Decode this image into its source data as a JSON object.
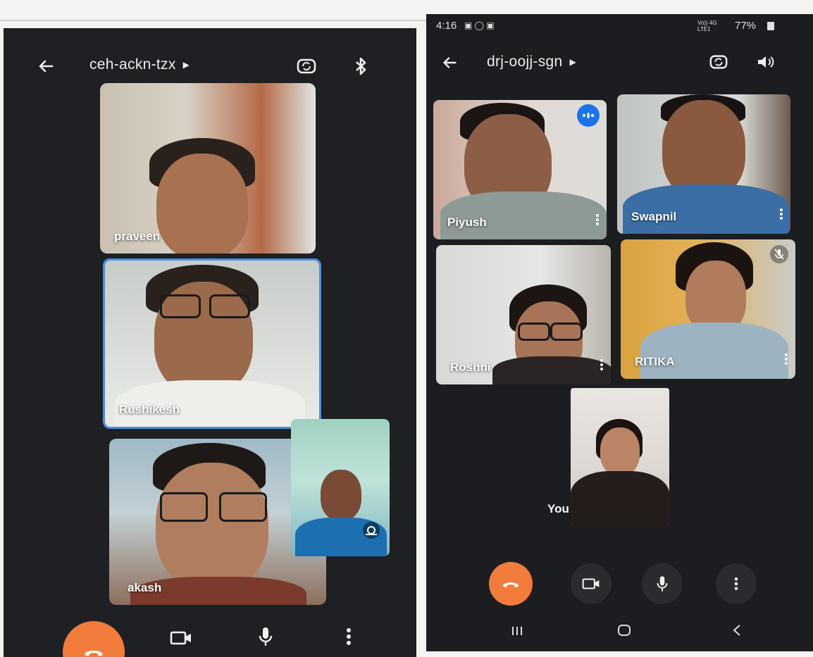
{
  "left_phone": {
    "meeting_code": "ceh-ackn-tzx",
    "icons": {
      "back": "arrow-left-icon",
      "switch_camera": "switch-camera-icon",
      "audio_output": "bluetooth-icon"
    },
    "participants": [
      {
        "name": "praveen"
      },
      {
        "name": "Rushikesh",
        "active_speaker": true
      },
      {
        "name": "akash"
      }
    ],
    "self_view": {
      "name": ""
    },
    "controls": [
      "end-call-icon",
      "camera-icon",
      "microphone-icon",
      "more-options-icon"
    ],
    "colors": {
      "end_call": "#f27c3c",
      "active_border": "#4a90e2",
      "background": "#1f2023"
    }
  },
  "right_phone": {
    "status": {
      "time": "4:16",
      "network": "Vo)) 4G LTE1",
      "battery": "77%"
    },
    "meeting_code": "drj-oojj-sgn",
    "icons": {
      "back": "arrow-left-icon",
      "switch_camera": "switch-camera-icon",
      "audio_output": "speaker-icon"
    },
    "participants": [
      {
        "name": "Piyush",
        "speaking": true
      },
      {
        "name": "Swapnil"
      },
      {
        "name": "Roshni"
      },
      {
        "name": "RITIKA",
        "muted": true
      }
    ],
    "self_view": {
      "name": "You"
    },
    "controls": [
      "end-call-icon",
      "camera-icon",
      "microphone-icon",
      "more-options-icon"
    ],
    "nav": [
      "recent-apps-icon",
      "home-icon",
      "back-nav-icon"
    ],
    "colors": {
      "end_call": "#f27c3c",
      "speaking_badge": "#1a73e8",
      "background": "#1c1d20"
    }
  }
}
